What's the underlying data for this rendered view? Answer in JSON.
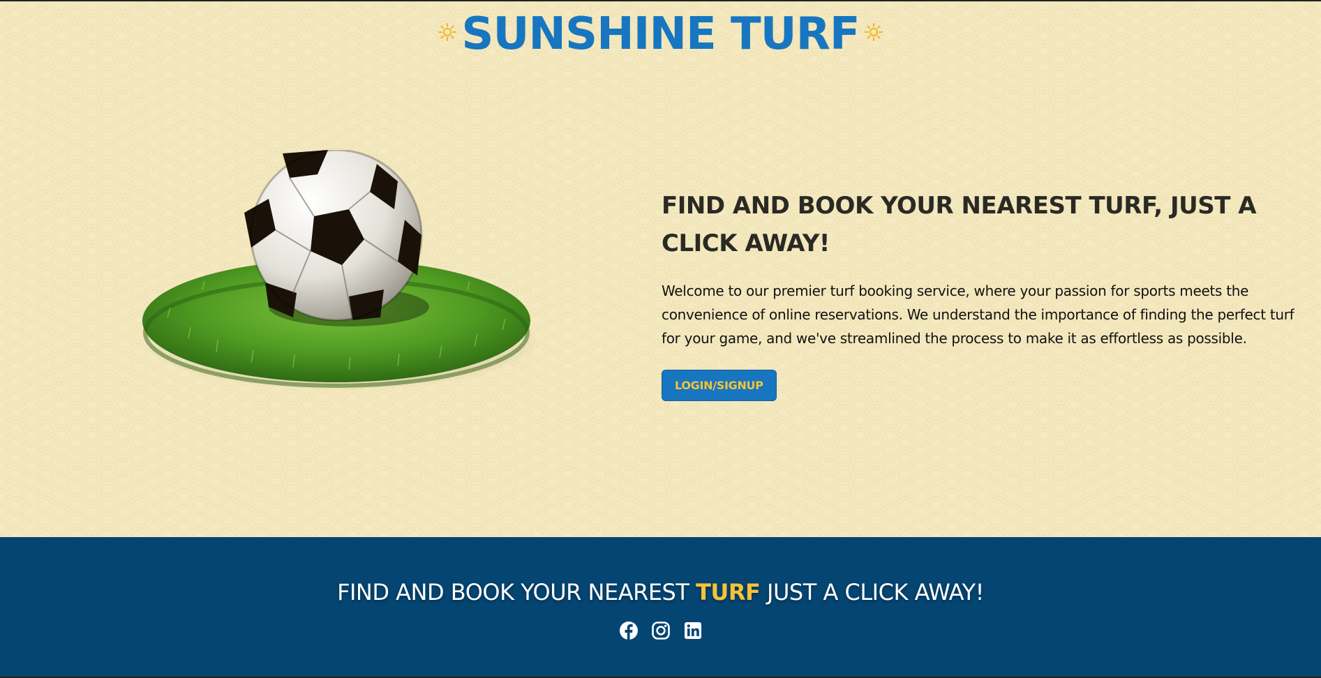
{
  "header": {
    "logo_text": "SUNSHINE TURF",
    "brand_color": "#1776bf"
  },
  "hero": {
    "image_icon": "soccer-ball-on-grass-image",
    "title": "FIND AND BOOK YOUR NEAREST TURF, JUST A CLICK AWAY!",
    "description": "Welcome to our premier turf booking service, where your passion for sports meets the convenience of online reservations. We understand the importance of finding the perfect turf for your game, and we've streamlined the process to make it as effortless as possible.",
    "button_label": "LOGIN/SIGNUP",
    "button_color": "#1776bf",
    "button_text_color": "#f5c33a"
  },
  "footer": {
    "tagline_before": "FIND AND BOOK YOUR NEAREST ",
    "tagline_highlight": "TURF",
    "tagline_after": " JUST A CLICK AWAY!",
    "background_color": "#054572",
    "highlight_color": "#f5c33a",
    "socials": [
      {
        "icon": "facebook-icon"
      },
      {
        "icon": "instagram-icon"
      },
      {
        "icon": "linkedin-icon"
      }
    ]
  }
}
